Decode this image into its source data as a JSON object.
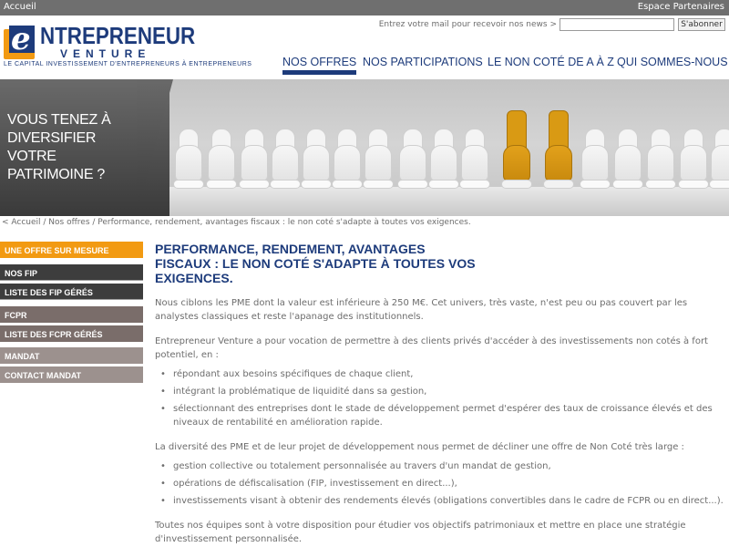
{
  "topbar": {
    "home": "Accueil",
    "partners": "Espace Partenaires"
  },
  "logo": {
    "mark_letter": "e",
    "word": "NTREPRENEUR",
    "sub": "VENTURE",
    "tagline": "LE CAPITAL INVESTISSEMENT D'ENTREPRENEURS À ENTREPRENEURS"
  },
  "newsletter": {
    "label": "Entrez votre mail pour recevoir nos news >",
    "input_value": "",
    "button": "S'abonner"
  },
  "nav": {
    "items": [
      {
        "label": "NOS OFFRES",
        "active": true
      },
      {
        "label": "NOS PARTICIPATIONS",
        "active": false
      },
      {
        "label": "LE NON COTÉ DE A À Z",
        "active": false
      },
      {
        "label": "QUI SOMMES-NOUS ?",
        "active": false
      }
    ]
  },
  "banner": {
    "text": "VOUS TENEZ À DIVERSIFIER VOTRE PATRIMOINE ?"
  },
  "breadcrumb": {
    "text": "< Accueil / Nos offres / Performance, rendement, avantages fiscaux : le non coté s'adapte à toutes vos exigences."
  },
  "sidebar": {
    "items": [
      {
        "label": "UNE OFFRE SUR MESURE",
        "style": "orange"
      },
      {
        "label": "NOS FIP",
        "style": "dark"
      },
      {
        "label": "LISTE DES FIP GÉRÉS",
        "style": "dark"
      },
      {
        "label": "FCPR",
        "style": "brown"
      },
      {
        "label": "LISTE DES FCPR GÉRÉS",
        "style": "brown"
      },
      {
        "label": "MANDAT",
        "style": "taupe"
      },
      {
        "label": "CONTACT MANDAT",
        "style": "taupe"
      }
    ]
  },
  "content": {
    "headline": "PERFORMANCE, RENDEMENT, AVANTAGES FISCAUX : LE NON COTÉ S'ADAPTE À TOUTES VOS EXIGENCES.",
    "p1": "Nous ciblons les PME dont la valeur est inférieure à 250 M€. Cet univers, très vaste, n'est peu ou pas couvert par les analystes classiques et reste l'apanage des institutionnels.",
    "p2": "Entrepreneur Venture a pour vocation de permettre à des clients privés d'accéder à des investissements non cotés à fort potentiel, en :",
    "list1": [
      "répondant aux besoins spécifiques de chaque client,",
      "intégrant la problématique de liquidité dans sa gestion,",
      "sélectionnant des entreprises dont le stade de développement permet d'espérer des taux de croissance élevés et des niveaux de rentabilité en amélioration rapide."
    ],
    "p3": "La diversité des PME et de leur projet de développement nous permet de décliner une offre de Non Coté très large :",
    "list2": [
      "gestion collective ou totalement personnalisée au travers d'un mandat de gestion,",
      "opérations de défiscalisation (FIP, investissement en direct...),",
      "investissements visant à obtenir des rendements élevés (obligations convertibles dans le cadre de FCPR ou en direct...)."
    ],
    "p4": "Toutes nos équipes sont à votre disposition pour étudier vos objectifs patrimoniaux et mettre en place une stratégie d'investissement personnalisée."
  },
  "colors": {
    "brand_blue": "#1d3b7b",
    "accent_orange": "#f29a12",
    "text_gray": "#6d6d6d"
  }
}
